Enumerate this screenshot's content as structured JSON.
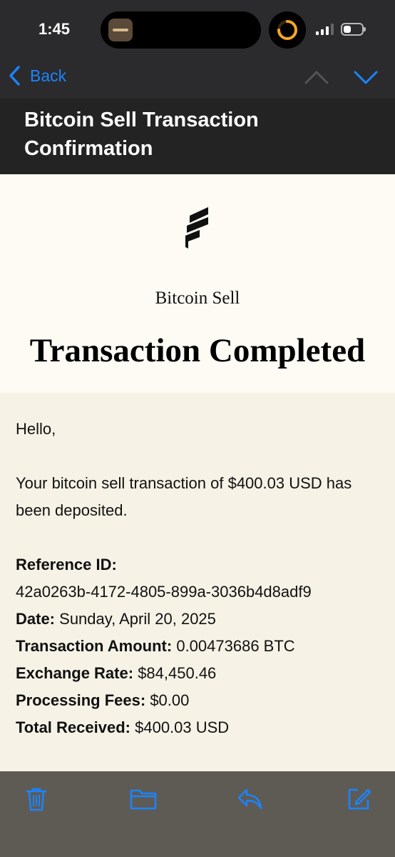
{
  "status": {
    "time": "1:45"
  },
  "nav": {
    "back_label": "Back"
  },
  "email": {
    "subject": "Bitcoin Sell Transaction Confirmation",
    "brand": "Bitcoin Sell",
    "headline": "Transaction Completed",
    "greeting": "Hello,",
    "message": "Your bitcoin sell transaction of $400.03 USD has been deposited.",
    "details": {
      "reference_label": "Reference ID:",
      "reference_value": "42a0263b-4172-4805-899a-3036b4d8adf9",
      "date_label": "Date:",
      "date_value": "Sunday, April 20, 2025",
      "amount_label": "Transaction Amount:",
      "amount_value": "0.00473686 BTC",
      "rate_label": "Exchange Rate:",
      "rate_value": "$84,450.46",
      "fees_label": "Processing Fees:",
      "fees_value": "$0.00",
      "total_label": "Total Received:",
      "total_value": "$400.03 USD"
    }
  },
  "colors": {
    "accent": "#1a84ff",
    "bar_dark": "#2b2b2d",
    "body_bg": "#f6f2e6",
    "header_bg": "#fdfbf4"
  },
  "icons": {
    "back": "chevron-left-icon",
    "prev": "chevron-up-icon",
    "next": "chevron-down-icon",
    "toolbar": [
      "trash-icon",
      "folder-icon",
      "reply-icon",
      "compose-icon"
    ]
  }
}
